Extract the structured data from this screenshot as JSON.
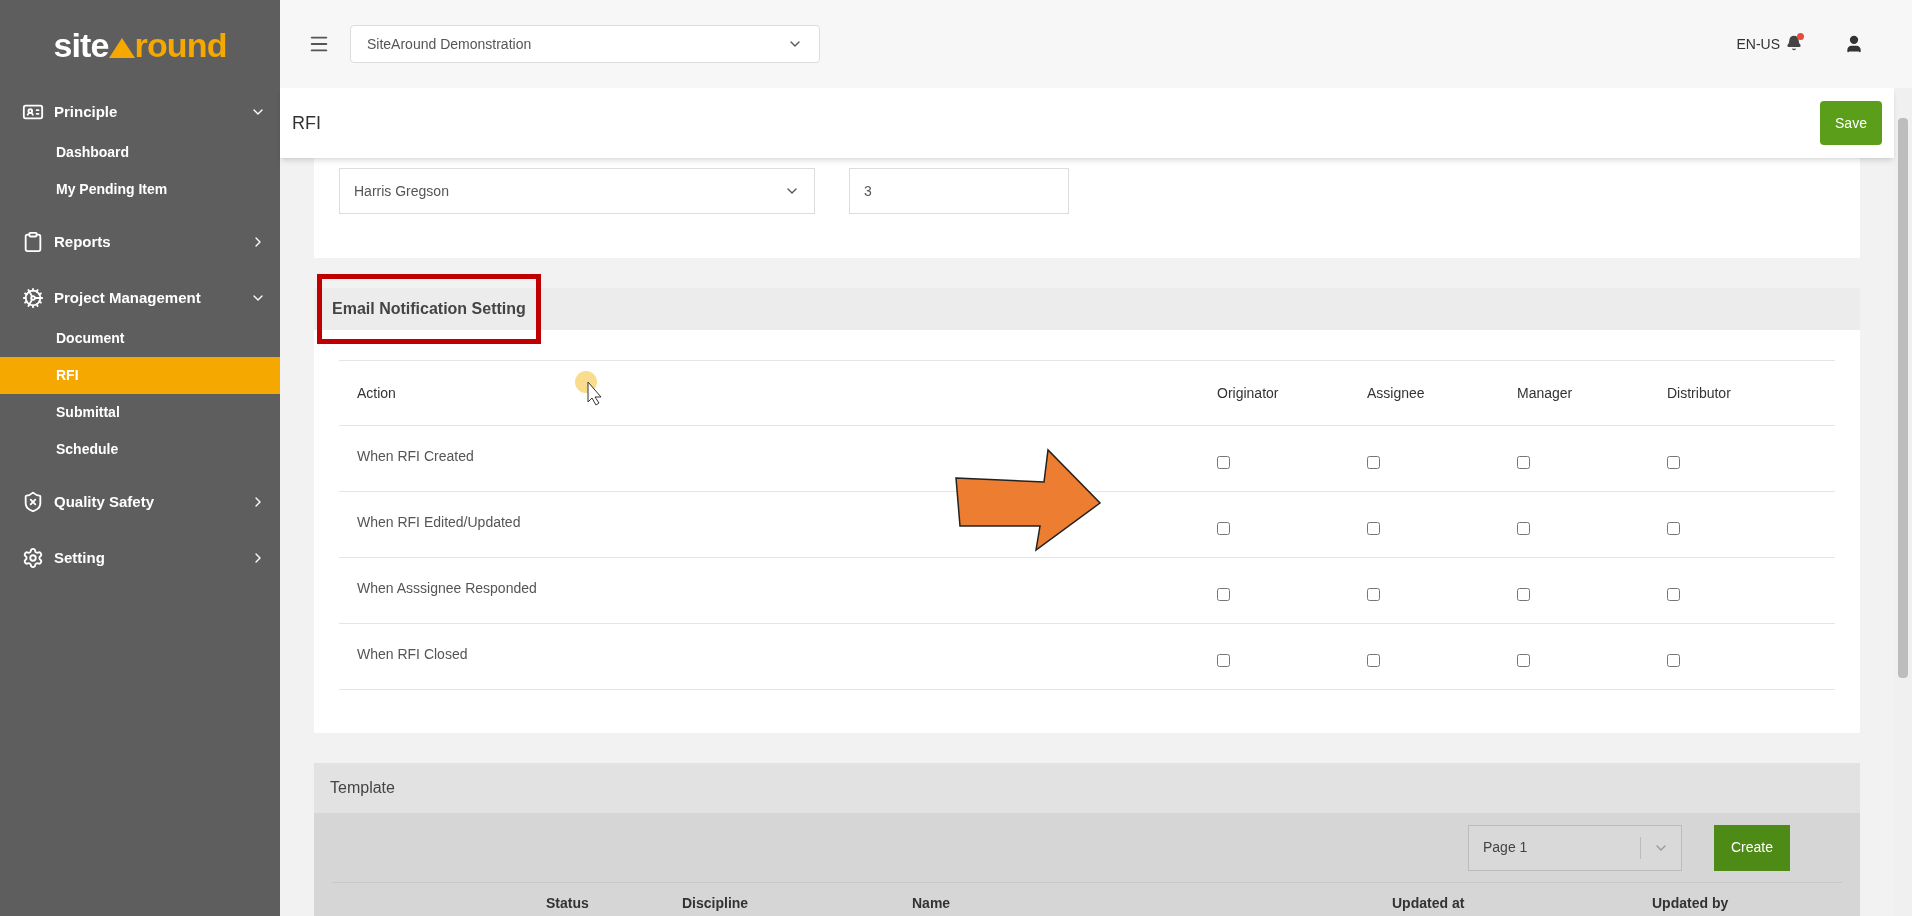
{
  "sidebar": {
    "logo": {
      "left": "site",
      "right": "round"
    },
    "sections": [
      {
        "label": "Principle",
        "expanded": true,
        "children": [
          {
            "label": "Dashboard",
            "selected": false
          },
          {
            "label": "My Pending Item",
            "selected": false
          }
        ]
      },
      {
        "label": "Reports",
        "expanded": false
      },
      {
        "label": "Project Management",
        "expanded": true,
        "children": [
          {
            "label": "Document",
            "selected": false
          },
          {
            "label": "RFI",
            "selected": true
          },
          {
            "label": "Submittal",
            "selected": false
          },
          {
            "label": "Schedule",
            "selected": false
          }
        ]
      },
      {
        "label": "Quality Safety",
        "expanded": false
      },
      {
        "label": "Setting",
        "expanded": false
      }
    ]
  },
  "topbar": {
    "project_select": "SiteAround Demonstration",
    "language": "EN-US",
    "notification": true
  },
  "page": {
    "title": "RFI",
    "save_button": "Save"
  },
  "assignment": {
    "person_select": "Harris Gregson",
    "number_value": "3"
  },
  "email_notification": {
    "title": "Email Notification Setting",
    "columns": [
      "Action",
      "Originator",
      "Assignee",
      "Manager",
      "Distributor"
    ],
    "rows": [
      {
        "action": "When RFI Created",
        "checks": [
          {
            "checked": false
          },
          {
            "checked": false
          },
          {
            "checked": false
          },
          {
            "checked": false
          }
        ]
      },
      {
        "action": "When RFI Edited/Updated",
        "checks": [
          {
            "checked": false
          },
          {
            "checked": false
          },
          {
            "checked": false
          },
          {
            "checked": false
          }
        ]
      },
      {
        "action": "When Asssignee Responded",
        "checks": [
          {
            "checked": false
          },
          {
            "checked": false
          },
          {
            "checked": false
          },
          {
            "checked": false
          }
        ]
      },
      {
        "action": "When RFI Closed",
        "checks": [
          {
            "checked": false
          },
          {
            "checked": false
          },
          {
            "checked": false
          },
          {
            "checked": false
          }
        ]
      }
    ]
  },
  "template": {
    "title": "Template",
    "page_select": "Page 1",
    "create_button": "Create",
    "columns": [
      "Status",
      "Discipline",
      "Name",
      "Updated at",
      "Updated by"
    ]
  }
}
